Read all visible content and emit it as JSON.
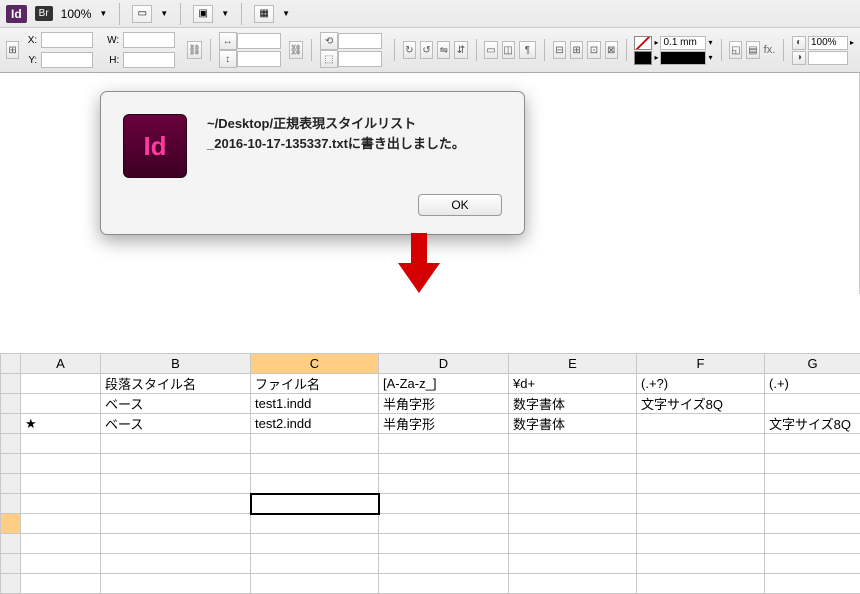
{
  "toolbar": {
    "app_label": "Id",
    "bridge_label": "Br",
    "zoom": "100%",
    "stroke_weight": "0.1 mm",
    "opacity": "100%",
    "x_label": "X:",
    "y_label": "Y:",
    "w_label": "W:",
    "h_label": "H:",
    "fx_label": "fx."
  },
  "dialog": {
    "icon_text": "Id",
    "line1": "~/Desktop/正規表現スタイルリスト",
    "line2": "_2016-10-17-135337.txtに書き出しました。",
    "ok": "OK"
  },
  "sheet": {
    "columns": [
      "",
      "A",
      "B",
      "C",
      "D",
      "E",
      "F",
      "G"
    ],
    "selected_col_index": 3,
    "selected_row_index": 7,
    "selected_cell": {
      "row": 7,
      "col": 3
    },
    "rows": [
      {
        "num": "",
        "cells": [
          "",
          "段落スタイル名",
          "ファイル名",
          "[A-Za-z_]",
          "¥d+",
          "(.+?)",
          "(.+)"
        ]
      },
      {
        "num": "",
        "cells": [
          "",
          "ベース",
          "test1.indd",
          "半角字形",
          "数字書体",
          "文字サイズ8Q",
          ""
        ]
      },
      {
        "num": "",
        "cells": [
          "★",
          "ベース",
          "test2.indd",
          "半角字形",
          "数字書体",
          "",
          "文字サイズ8Q"
        ]
      },
      {
        "num": "",
        "cells": [
          "",
          "",
          "",
          "",
          "",
          "",
          ""
        ]
      },
      {
        "num": "",
        "cells": [
          "",
          "",
          "",
          "",
          "",
          "",
          ""
        ]
      },
      {
        "num": "",
        "cells": [
          "",
          "",
          "",
          "",
          "",
          "",
          ""
        ]
      },
      {
        "num": "",
        "cells": [
          "",
          "",
          "",
          "",
          "",
          "",
          ""
        ]
      },
      {
        "num": "",
        "cells": [
          "",
          "",
          "",
          "",
          "",
          "",
          ""
        ]
      },
      {
        "num": "",
        "cells": [
          "",
          "",
          "",
          "",
          "",
          "",
          ""
        ]
      },
      {
        "num": "",
        "cells": [
          "",
          "",
          "",
          "",
          "",
          "",
          ""
        ]
      },
      {
        "num": "",
        "cells": [
          "",
          "",
          "",
          "",
          "",
          "",
          ""
        ]
      }
    ]
  }
}
